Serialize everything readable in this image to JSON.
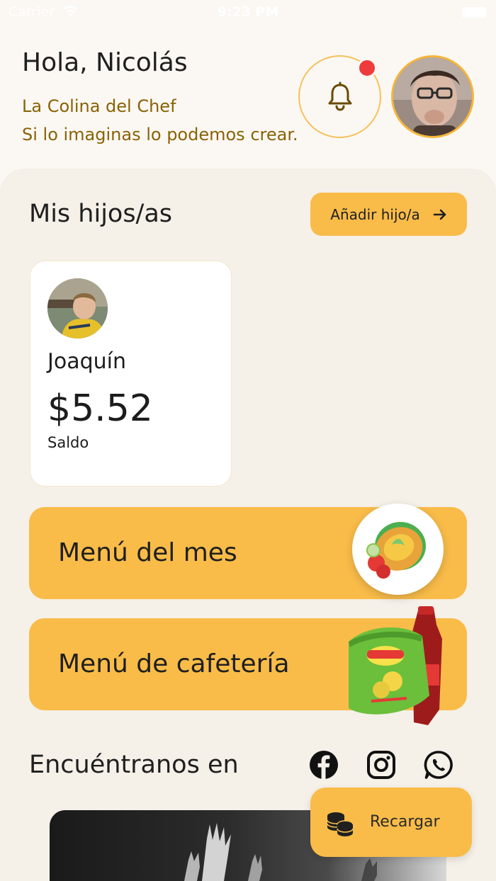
{
  "status_bar": {
    "carrier": "Carrier",
    "time": "9:23 PM"
  },
  "header": {
    "greeting": "Hola, Nicolás",
    "school_name": "La Colina del Chef",
    "slogan": "Si lo imaginas lo podemos crear.",
    "notification_icon": "bell-icon",
    "has_notification": true
  },
  "children_section": {
    "title": "Mis hijos/as",
    "add_button_label": "Añadir hijo/a",
    "children": [
      {
        "name": "Joaquín",
        "balance": "$5.52",
        "balance_label": "Saldo"
      }
    ]
  },
  "menus": [
    {
      "label": "Menú del mes",
      "icon": "salad-plate-icon"
    },
    {
      "label": "Menú de cafetería",
      "icon": "snacks-soda-icon"
    }
  ],
  "social": {
    "title": "Encuéntranos en",
    "networks": [
      "facebook-icon",
      "instagram-icon",
      "whatsapp-icon"
    ]
  },
  "recharge_button": {
    "label": "Recargar",
    "icon": "coins-icon"
  },
  "colors": {
    "accent": "#F9BC49",
    "background": "#F5F0E8",
    "brand_text": "#8A6206",
    "notification": "#EE3B3B"
  }
}
